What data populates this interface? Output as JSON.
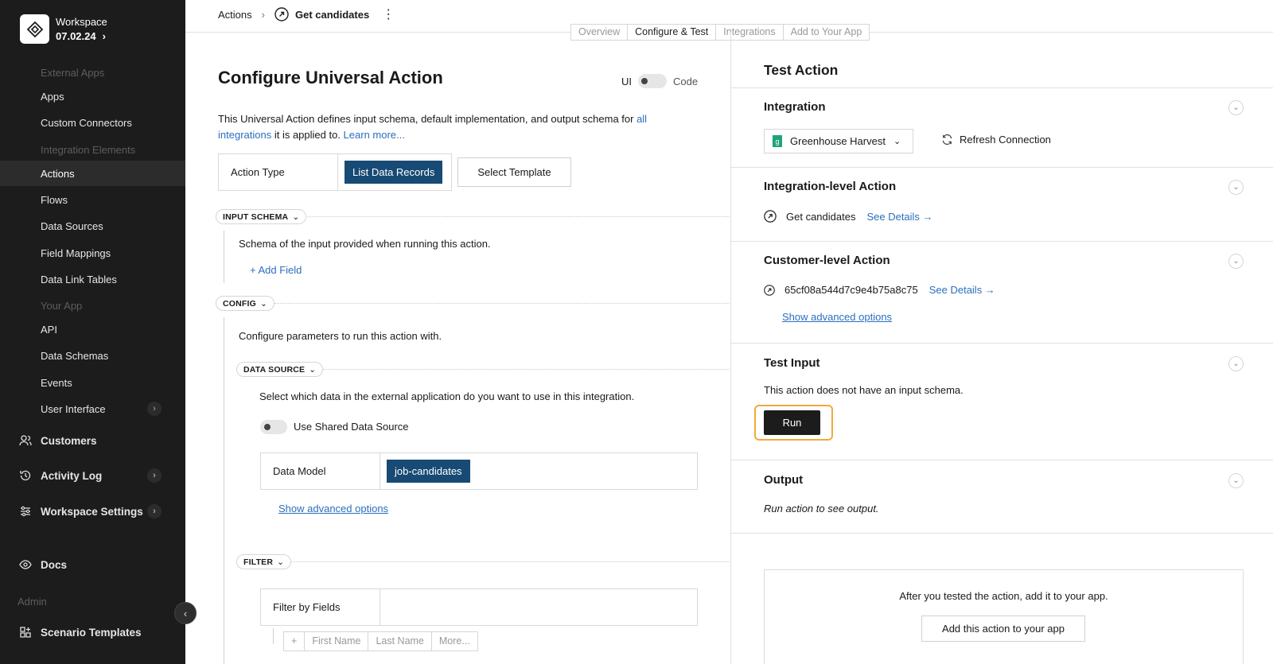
{
  "sidebar": {
    "workspace_name": "Workspace",
    "workspace_date": "07.02.24",
    "sections": {
      "external_apps": "External Apps",
      "integration_elements": "Integration Elements",
      "your_app": "Your App",
      "admin": "Admin"
    },
    "items": {
      "apps": "Apps",
      "custom_connectors": "Custom Connectors",
      "actions": "Actions",
      "flows": "Flows",
      "data_sources": "Data Sources",
      "field_mappings": "Field Mappings",
      "data_link_tables": "Data Link Tables",
      "api": "API",
      "data_schemas": "Data Schemas",
      "events": "Events",
      "user_interface": "User Interface",
      "customers": "Customers",
      "activity_log": "Activity Log",
      "workspace_settings": "Workspace Settings",
      "docs": "Docs",
      "scenario_templates": "Scenario Templates"
    }
  },
  "header": {
    "breadcrumb_root": "Actions",
    "breadcrumb_current": "Get candidates",
    "tabs": [
      "Overview",
      "Configure & Test",
      "Integrations",
      "Add to Your App"
    ],
    "active_tab": "Configure & Test"
  },
  "main": {
    "title": "Configure Universal Action",
    "ui_label": "UI",
    "code_label": "Code",
    "desc_pre": "This Universal Action defines input schema, default implementation, and output schema for ",
    "desc_link": "all integrations",
    "desc_mid": " it is applied to. ",
    "desc_learn": "Learn more...",
    "action_type_label": "Action Type",
    "action_type_value": "List Data Records",
    "select_template": "Select Template",
    "input_schema_chip": "INPUT SCHEMA",
    "input_schema_desc": "Schema of the input provided when running this action.",
    "add_field": "+ Add Field",
    "config_chip": "CONFIG",
    "config_desc": "Configure parameters to run this action with.",
    "data_source_chip": "DATA SOURCE",
    "data_source_desc": "Select which data in the external application do you want to use in this integration.",
    "use_shared": "Use Shared Data Source",
    "data_model_label": "Data Model",
    "data_model_value": "job-candidates",
    "show_advanced": "Show advanced options",
    "filter_chip": "FILTER",
    "filter_label": "Filter by Fields",
    "field_chips": [
      "+",
      "First Name",
      "Last Name",
      "More..."
    ]
  },
  "test": {
    "title": "Test Action",
    "integration_h": "Integration",
    "integration_value": "Greenhouse Harvest",
    "refresh": "Refresh Connection",
    "int_level_h": "Integration-level Action",
    "int_level_name": "Get candidates",
    "see_details": "See Details →",
    "cust_level_h": "Customer-level Action",
    "cust_level_id": "65cf08a544d7c9e4b75a8c75",
    "show_advanced": "Show advanced options",
    "test_input_h": "Test Input",
    "test_input_desc": "This action does not have an input schema.",
    "run": "Run",
    "output_h": "Output",
    "output_desc": "Run action to see output.",
    "add_desc": "After you tested the action, add it to your app.",
    "add_btn": "Add this action to your app"
  },
  "colors": {
    "accent": "#174a74",
    "link": "#2b6fbd",
    "highlight": "#f2a93b",
    "sidebar": "#1c1c1c"
  }
}
